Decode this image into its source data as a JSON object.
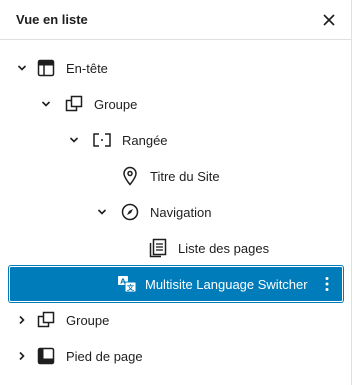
{
  "header": {
    "title": "Vue en liste"
  },
  "tree": {
    "rows": [
      {
        "label": "En-tête",
        "chevron": "chevron-down",
        "icon": "header-layout-icon"
      },
      {
        "label": "Groupe",
        "chevron": "chevron-down",
        "icon": "group-icon"
      },
      {
        "label": "Rangée",
        "chevron": "chevron-down",
        "icon": "row-icon"
      },
      {
        "label": "Titre du Site",
        "chevron": "",
        "icon": "map-pin-icon"
      },
      {
        "label": "Navigation",
        "chevron": "chevron-down",
        "icon": "compass-icon"
      },
      {
        "label": "Liste des pages",
        "chevron": "",
        "icon": "page-list-icon"
      },
      {
        "label": "Multisite Language Switcher",
        "chevron": "",
        "icon": "translate-icon",
        "selected": true
      },
      {
        "label": "Groupe",
        "chevron": "chevron-right",
        "icon": "group-icon"
      },
      {
        "label": "Pied de page",
        "chevron": "chevron-right",
        "icon": "footer-layout-icon"
      }
    ]
  },
  "colors": {
    "accent": "#007cba",
    "text": "#1e1e1e",
    "border": "#e0e0e0"
  }
}
